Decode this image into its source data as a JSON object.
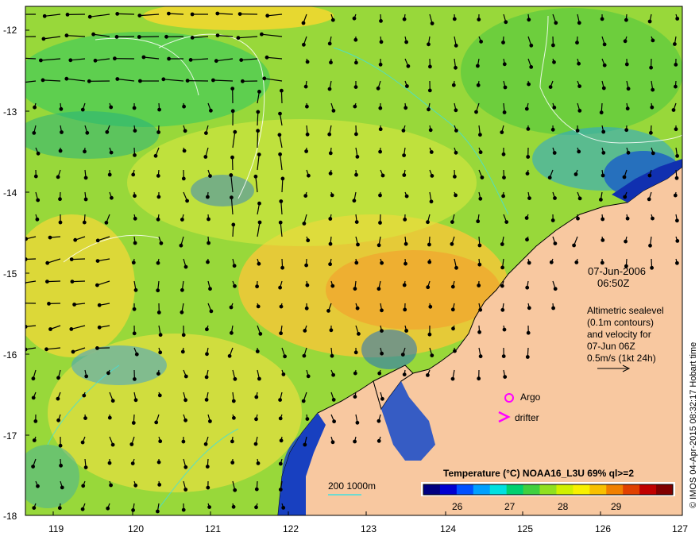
{
  "map": {
    "lon_range": [
      118.6,
      127.0
    ],
    "lat_range": [
      -18.0,
      -11.7
    ],
    "x_ticks": [
      "119",
      "120",
      "121",
      "122",
      "123",
      "124",
      "125",
      "126",
      "127"
    ],
    "y_ticks": [
      "-12",
      "-13",
      "-14",
      "-15",
      "-16",
      "-17",
      "-18"
    ],
    "land_color": "#f8c8a0",
    "sea_color": "#9ad83c"
  },
  "annotations": {
    "date": "07-Jun-2006",
    "time": "06:50Z",
    "alt_line1": "Altimetric sealevel",
    "alt_line2": "(0.1m contours)",
    "alt_line3": "and velocity for",
    "alt_line4": "07-Jun 06Z",
    "alt_line5": "0.5m/s (1kt 24h)",
    "argo_label": "Argo",
    "drifter_label": "drifter",
    "depth_legend": "200  1000m",
    "credit": "© IMOS 04-Apr-2015 08:32:17 Hobart time"
  },
  "colorbar": {
    "title": "Temperature (°C) NOAA16_L3U 69% ql>=2",
    "ticks": [
      "26",
      "27",
      "28",
      "29"
    ],
    "colors": [
      "#000080",
      "#0000d0",
      "#0050ff",
      "#00a0ff",
      "#00e0e0",
      "#00d070",
      "#40d040",
      "#90e020",
      "#d0f000",
      "#f8f000",
      "#f8c000",
      "#f08000",
      "#e04000",
      "#c00000",
      "#800000"
    ]
  }
}
